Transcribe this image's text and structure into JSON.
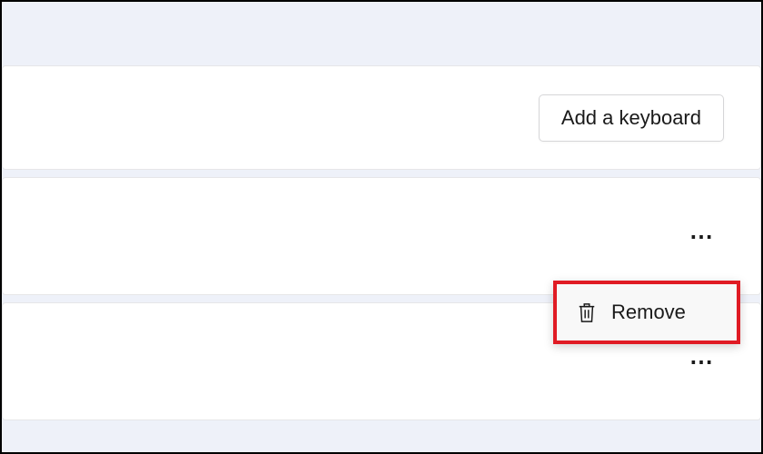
{
  "rows": {
    "addKeyboard": {
      "label": "Add a keyboard"
    }
  },
  "contextMenu": {
    "remove": {
      "label": "Remove",
      "iconName": "trash-icon"
    }
  },
  "icons": {
    "moreHorizontal": "⋯"
  }
}
